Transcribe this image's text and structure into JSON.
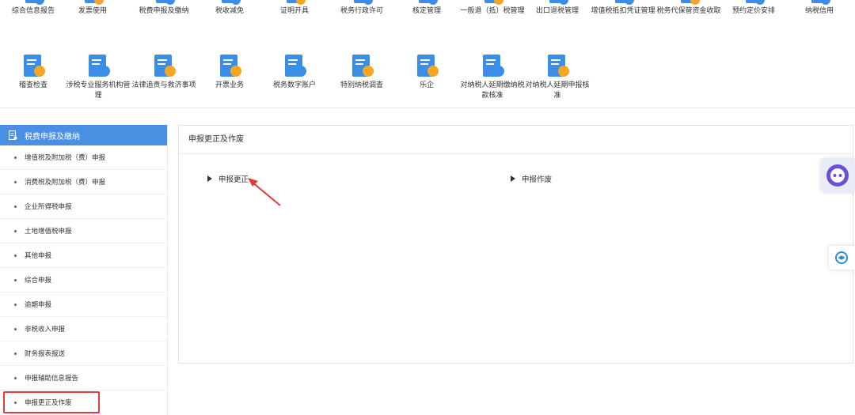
{
  "top_row1": [
    {
      "label": "综合信息报告",
      "icon": "report-icon"
    },
    {
      "label": "发票使用",
      "icon": "invoice-icon"
    },
    {
      "label": "税费申报及缴纳",
      "icon": "declare-icon"
    },
    {
      "label": "税收减免",
      "icon": "reduction-icon"
    },
    {
      "label": "证明开具",
      "icon": "certificate-icon"
    },
    {
      "label": "税务行政许可",
      "icon": "license-icon"
    },
    {
      "label": "核定管理",
      "icon": "assessment-icon"
    },
    {
      "label": "一般退（抵）税管理",
      "icon": "refund-icon"
    },
    {
      "label": "出口退税管理",
      "icon": "export-refund-icon"
    },
    {
      "label": "增值税抵扣凭证管理",
      "icon": "vat-deduction-icon"
    },
    {
      "label": "税务代保管资金收取",
      "icon": "custody-fund-icon"
    },
    {
      "label": "预约定价安排",
      "icon": "pricing-icon"
    },
    {
      "label": "纳税信用",
      "icon": "credit-icon"
    }
  ],
  "top_row2": [
    {
      "label": "稽查检查",
      "icon": "inspection-icon"
    },
    {
      "label": "涉税专业服务机构管理",
      "icon": "agency-icon"
    },
    {
      "label": "法律追责与救济事项",
      "icon": "legal-icon"
    },
    {
      "label": "开票业务",
      "icon": "issue-invoice-icon"
    },
    {
      "label": "税务数字账户",
      "icon": "digital-account-icon"
    },
    {
      "label": "特别纳税调查",
      "icon": "special-investigation-icon"
    },
    {
      "label": "乐企",
      "icon": "leqi-icon"
    },
    {
      "label": "对纳税人延期缴纳税款核准",
      "icon": "deferred-payment-icon"
    },
    {
      "label": "对纳税人延期申报核准",
      "icon": "deferred-declare-icon"
    }
  ],
  "sidebar": {
    "title": "税费申报及缴纳",
    "items": [
      "增值税及附加税（费）申报",
      "消费税及附加税（费）申报",
      "企业所得税申报",
      "土地增值税申报",
      "其他申报",
      "综合申报",
      "逾期申报",
      "非税收入申报",
      "财务报表报送",
      "申报辅助信息报告",
      "申报更正及作废"
    ],
    "active_index": 10
  },
  "panel": {
    "title": "申报更正及作废",
    "links": [
      "申报更正",
      "申报作废"
    ]
  },
  "colors": {
    "accent": "#4a90e2",
    "highlight": "#e03c3c",
    "icon_blue": "#3b8ee8",
    "icon_orange": "#f5a623"
  }
}
